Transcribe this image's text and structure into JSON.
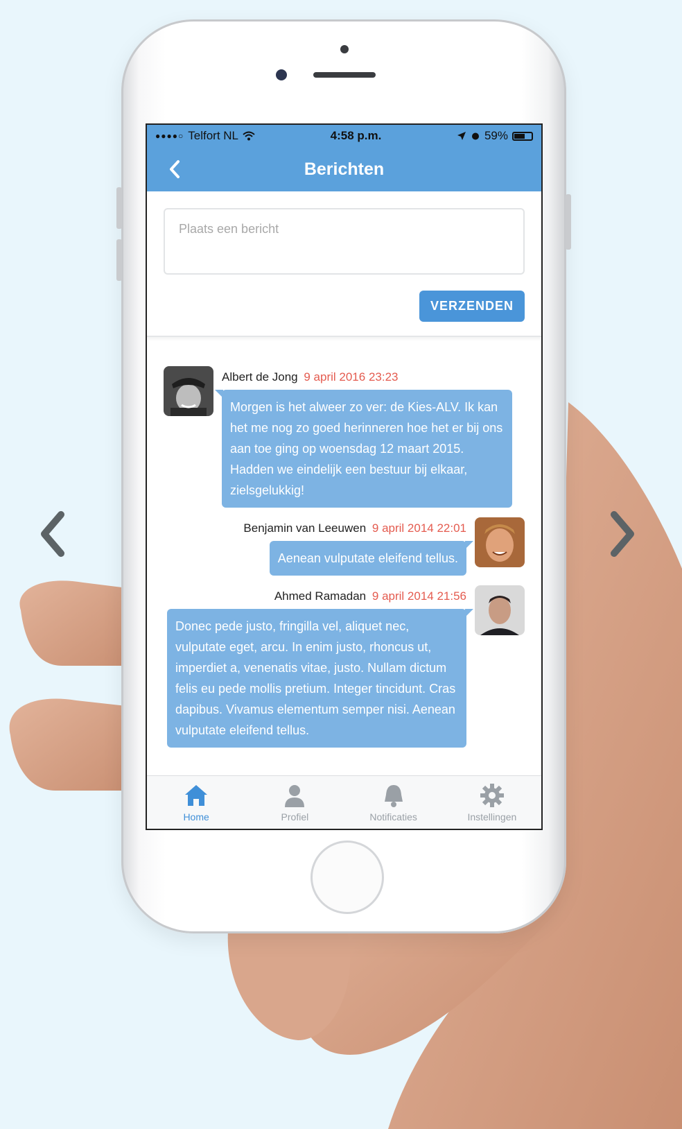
{
  "carousel": {
    "prev_icon": "chevron-left-icon",
    "next_icon": "chevron-right-icon"
  },
  "status_bar": {
    "carrier": "Telfort NL",
    "signal": "●●●●○",
    "time": "4:58 p.m.",
    "battery": "59%"
  },
  "nav": {
    "title": "Berichten",
    "back_icon": "chevron-left-icon"
  },
  "compose": {
    "placeholder": "Plaats een bericht",
    "value": "",
    "send_label": "VERZENDEN"
  },
  "messages": [
    {
      "author": "Albert de Jong",
      "time": "9 april 2016 23:23",
      "text": "Morgen is het alweer zo ver: de Kies-ALV. Ik kan het me nog zo goed herinneren hoe het er bij ons aan toe ging op woensdag 12 maart 2015. Hadden we eindelijk een bestuur bij elkaar, zielsgelukkig!",
      "align": "left"
    },
    {
      "author": "Benjamin van Leeuwen",
      "time": "9 april 2014 22:01",
      "text": "Aenean vulputate eleifend tellus.",
      "align": "right"
    },
    {
      "author": "Ahmed Ramadan",
      "time": "9 april 2014 21:56",
      "text": "Donec pede justo, fringilla vel, aliquet nec, vulputate eget, arcu. In enim justo, rhoncus ut, imperdiet a, venenatis vitae, justo. Nullam dictum felis eu pede mollis pretium. Integer tincidunt. Cras dapibus. Vivamus elementum semper nisi. Aenean vulputate eleifend tellus.",
      "align": "right"
    }
  ],
  "tabs": [
    {
      "label": "Home",
      "icon": "home-icon",
      "active": true
    },
    {
      "label": "Profiel",
      "icon": "user-icon",
      "active": false
    },
    {
      "label": "Notificaties",
      "icon": "bell-icon",
      "active": false
    },
    {
      "label": "Instellingen",
      "icon": "gear-icon",
      "active": false
    }
  ],
  "colors": {
    "brand": "#5ba1dc",
    "bubble": "#7db3e3",
    "timestamp": "#e45b4f",
    "active_tab": "#3f8fd8",
    "background": "#e9f6fc"
  }
}
